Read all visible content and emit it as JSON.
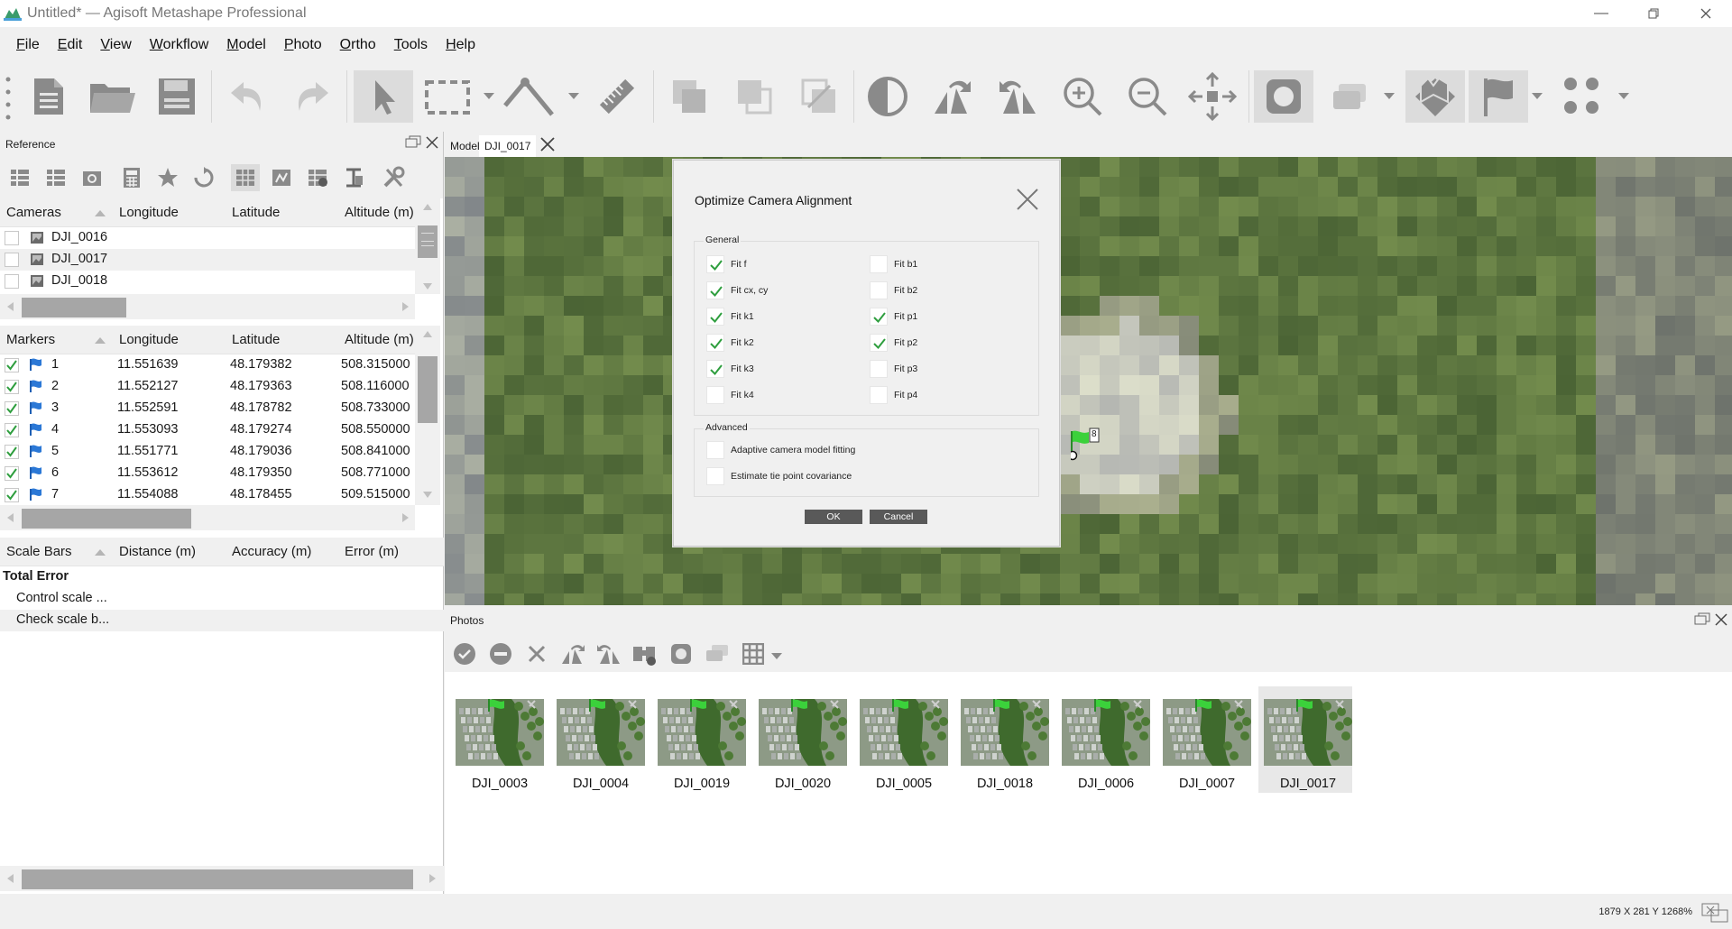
{
  "window": {
    "title": "Untitled* — Agisoft Metashape Professional",
    "controls": [
      "minimize-icon",
      "restore-icon",
      "close-icon"
    ]
  },
  "menu": {
    "items": [
      {
        "u": "F",
        "rest": "ile"
      },
      {
        "u": "E",
        "rest": "dit"
      },
      {
        "u": "V",
        "rest": "iew"
      },
      {
        "u": "W",
        "rest": "orkflow"
      },
      {
        "u": "M",
        "rest": "odel"
      },
      {
        "u": "P",
        "rest": "hoto"
      },
      {
        "u": "O",
        "rest": "rtho"
      },
      {
        "u": "T",
        "rest": "ools"
      },
      {
        "u": "H",
        "rest": "elp"
      }
    ]
  },
  "toolbar": {
    "icons": [
      "new-document-icon",
      "open-folder-icon",
      "save-icon",
      "undo-icon",
      "redo-icon",
      "navigation-arrow-icon",
      "rectangle-selection-icon",
      "ruler-tool-icon",
      "measure-icon",
      "crop-icon",
      "crop-subtract-icon",
      "crop-intersect-icon",
      "contrast-icon",
      "rotate-left-icon",
      "rotate-right-icon",
      "zoom-in-icon",
      "zoom-out-icon",
      "reset-view-icon",
      "show-cameras-icon",
      "show-shapes-icon",
      "show-markers-icon",
      "show-flags-icon",
      "show-points-icon"
    ]
  },
  "reference": {
    "title": "Reference",
    "cameras_header": [
      "Cameras",
      "Longitude",
      "Latitude",
      "Altitude (m)"
    ],
    "cameras": [
      "DJI_0016",
      "DJI_0017",
      "DJI_0018"
    ],
    "markers_header": [
      "Markers",
      "Longitude",
      "Latitude",
      "Altitude (m)"
    ],
    "markers": [
      {
        "id": "1",
        "lon": "11.551639",
        "lat": "48.179382",
        "alt": "508.315000"
      },
      {
        "id": "2",
        "lon": "11.552127",
        "lat": "48.179363",
        "alt": "508.116000"
      },
      {
        "id": "3",
        "lon": "11.552591",
        "lat": "48.178782",
        "alt": "508.733000"
      },
      {
        "id": "4",
        "lon": "11.553093",
        "lat": "48.179274",
        "alt": "508.550000"
      },
      {
        "id": "5",
        "lon": "11.551771",
        "lat": "48.179036",
        "alt": "508.841000"
      },
      {
        "id": "6",
        "lon": "11.553612",
        "lat": "48.179350",
        "alt": "508.771000"
      },
      {
        "id": "7",
        "lon": "11.554088",
        "lat": "48.178455",
        "alt": "509.515000"
      }
    ],
    "scalebars_header": [
      "Scale Bars",
      "Distance (m)",
      "Accuracy (m)",
      "Error (m)"
    ],
    "total_error": "Total Error",
    "control_scale": "Control scale ...",
    "check_scale": "Check scale b..."
  },
  "view": {
    "tabs": [
      "Model",
      "DJI_0017"
    ],
    "marker_label": "8"
  },
  "dialog": {
    "title": "Optimize Camera Alignment",
    "general_label": "General",
    "left_options": [
      {
        "label": "Fit f",
        "checked": true
      },
      {
        "label": "Fit cx, cy",
        "checked": true
      },
      {
        "label": "Fit k1",
        "checked": true
      },
      {
        "label": "Fit k2",
        "checked": true
      },
      {
        "label": "Fit k3",
        "checked": true
      },
      {
        "label": "Fit k4",
        "checked": false
      }
    ],
    "right_options": [
      {
        "label": "Fit b1",
        "checked": false
      },
      {
        "label": "Fit b2",
        "checked": false
      },
      {
        "label": "Fit p1",
        "checked": true
      },
      {
        "label": "Fit p2",
        "checked": true
      },
      {
        "label": "Fit p3",
        "checked": false
      },
      {
        "label": "Fit p4",
        "checked": false
      }
    ],
    "advanced_label": "Advanced",
    "advanced_options": [
      {
        "label": "Adaptive camera model fitting",
        "checked": false
      },
      {
        "label": "Estimate tie point covariance",
        "checked": false
      }
    ],
    "ok": "OK",
    "cancel": "Cancel"
  },
  "photos": {
    "title": "Photos",
    "items": [
      "DJI_0003",
      "DJI_0004",
      "DJI_0019",
      "DJI_0020",
      "DJI_0005",
      "DJI_0018",
      "DJI_0006",
      "DJI_0007",
      "DJI_0017"
    ],
    "selected": "DJI_0017"
  },
  "status": {
    "coords": "1879 X  281 Y  1268%"
  }
}
